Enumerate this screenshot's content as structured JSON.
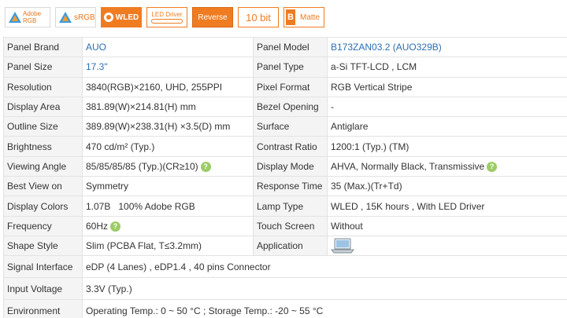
{
  "badges": {
    "adobe": "Adobe RGB",
    "srgb": "sRGB",
    "wled": "WLED",
    "led_driver": "LED Driver",
    "reverse": "Reverse",
    "ten_bit": "10 bit",
    "matte_letter": "B",
    "matte": "Matte"
  },
  "icons": {
    "help": "help-circle-icon",
    "application": "laptop-icon"
  },
  "colors": {
    "accent": "#f07c22",
    "link": "#2a6fb5",
    "help": "#9ccc65"
  },
  "spec": {
    "rows": [
      {
        "l1": "Panel Brand",
        "v1": "AUO",
        "l2": "Panel Model",
        "v2": "B173ZAN03.2 (AUO329B)"
      },
      {
        "l1": "Panel Size",
        "v1": "17.3\"",
        "l2": "Panel Type",
        "v2": "a-Si TFT-LCD , LCM"
      },
      {
        "l1": "Resolution",
        "v1": "3840(RGB)×2160, UHD, 255PPI",
        "l2": "Pixel Format",
        "v2": "RGB Vertical Stripe"
      },
      {
        "l1": "Display Area",
        "v1": "381.89(W)×214.81(H) mm",
        "l2": "Bezel Opening",
        "v2": "-"
      },
      {
        "l1": "Outline Size",
        "v1": "389.89(W)×238.31(H) ×3.5(D) mm",
        "l2": "Surface",
        "v2": "Antiglare"
      },
      {
        "l1": "Brightness",
        "v1": "470 cd/m² (Typ.)",
        "l2": "Contrast Ratio",
        "v2": "1200:1 (Typ.) (TM)"
      },
      {
        "l1": "Viewing Angle",
        "v1": "85/85/85/85 (Typ.)(CR≥10)",
        "l2": "Display Mode",
        "v2": "AHVA, Normally Black, Transmissive"
      },
      {
        "l1": "Best View on",
        "v1": "Symmetry",
        "l2": "Response Time",
        "v2": "35 (Max.)(Tr+Td)"
      },
      {
        "l1": "Display Colors",
        "v1": "1.07B   100% Adobe RGB",
        "l2": "Lamp Type",
        "v2": "WLED , 15K hours , With LED Driver"
      },
      {
        "l1": "Frequency",
        "v1": "60Hz",
        "l2": "Touch Screen",
        "v2": "Without"
      },
      {
        "l1": "Shape Style",
        "v1": "Slim (PCBA Flat, T≤3.2mm)",
        "l2": "Application",
        "v2": ""
      },
      {
        "l1": "Signal Interface",
        "v1": "eDP (4 Lanes) , eDP1.4 , 40 pins Connector"
      },
      {
        "l1": "Input Voltage",
        "v1": "3.3V (Typ.)"
      },
      {
        "l1": "Environment",
        "v1": "Operating Temp.: 0 ~ 50 °C ; Storage Temp.: -20 ~ 55 °C"
      }
    ]
  }
}
